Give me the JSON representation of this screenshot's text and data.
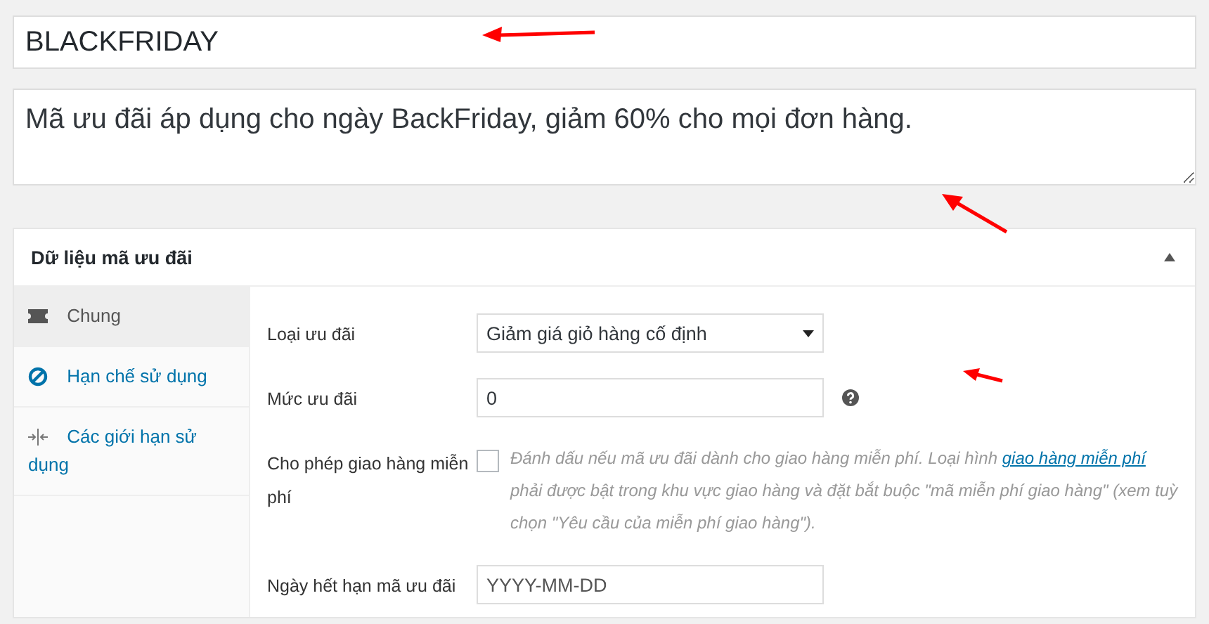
{
  "title_field": {
    "value": "BLACKFRIDAY"
  },
  "description_field": {
    "value": "Mã ưu đãi áp dụng cho ngày BackFriday, giảm 60% cho mọi đơn hàng."
  },
  "panel": {
    "title": "Dữ liệu mã ưu đãi",
    "expanded": true,
    "tabs": [
      {
        "label": "Chung",
        "kind": "ticket",
        "selected": true
      },
      {
        "label": "Hạn chế sử dụng",
        "kind": "ban",
        "selected": false
      },
      {
        "label": "Các giới hạn sử dụng",
        "kind": "limits",
        "selected": false
      }
    ],
    "fields": [
      {
        "kind": "select",
        "label": "Loại ưu đãi",
        "value": "Giảm giá giỏ hàng cố định"
      },
      {
        "kind": "input",
        "label": "Mức ưu đãi",
        "value": "0",
        "help": true
      },
      {
        "kind": "checkbox",
        "label": "Cho phép giao hàng miễn phí",
        "checked": false,
        "description_before": "Đánh dấu nếu mã ưu đãi dành cho giao hàng miễn phí. Loại hình ",
        "link": "giao hàng miễn phí",
        "description_after": " phải được bật trong khu vực giao hàng và đặt bắt buộc \"mã miễn phí giao hàng\" (xem tuỳ chọn \"Yêu cầu của miễn phí giao hàng\")."
      },
      {
        "kind": "input",
        "label": "Ngày hết hạn mã ưu đãi",
        "placeholder": "YYYY-MM-DD"
      }
    ]
  }
}
